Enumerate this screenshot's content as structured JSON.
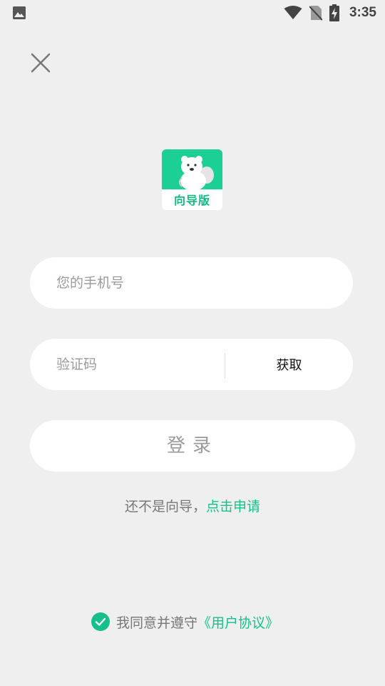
{
  "status_bar": {
    "time": "3:35",
    "icons": [
      "image-notification-icon",
      "wifi-icon",
      "no-sim-icon",
      "battery-charging-icon"
    ]
  },
  "header": {
    "close_icon": "close-icon"
  },
  "logo": {
    "text": "向导版",
    "accent_color": "#1ccf95"
  },
  "form": {
    "phone_placeholder": "您的手机号",
    "phone_value": "",
    "code_placeholder": "验证码",
    "code_value": "",
    "get_code_label": "获取",
    "login_label": "登录"
  },
  "apply": {
    "prefix": "还不是向导，",
    "link": "点击申请"
  },
  "agreement": {
    "prefix": "我同意并遵守",
    "link": "《用户协议》",
    "checked": true
  },
  "colors": {
    "background": "#efefef",
    "accent": "#17c08a",
    "placeholder": "#9a9a9a"
  }
}
